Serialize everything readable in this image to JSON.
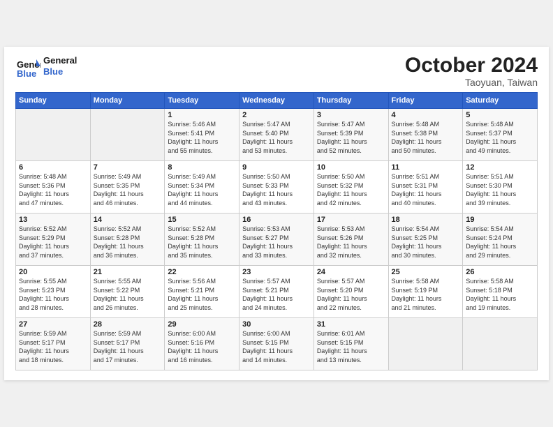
{
  "header": {
    "logo_line1": "General",
    "logo_line2": "Blue",
    "month": "October 2024",
    "location": "Taoyuan, Taiwan"
  },
  "days_of_week": [
    "Sunday",
    "Monday",
    "Tuesday",
    "Wednesday",
    "Thursday",
    "Friday",
    "Saturday"
  ],
  "weeks": [
    [
      {
        "day": "",
        "info": ""
      },
      {
        "day": "",
        "info": ""
      },
      {
        "day": "1",
        "info": "Sunrise: 5:46 AM\nSunset: 5:41 PM\nDaylight: 11 hours\nand 55 minutes."
      },
      {
        "day": "2",
        "info": "Sunrise: 5:47 AM\nSunset: 5:40 PM\nDaylight: 11 hours\nand 53 minutes."
      },
      {
        "day": "3",
        "info": "Sunrise: 5:47 AM\nSunset: 5:39 PM\nDaylight: 11 hours\nand 52 minutes."
      },
      {
        "day": "4",
        "info": "Sunrise: 5:48 AM\nSunset: 5:38 PM\nDaylight: 11 hours\nand 50 minutes."
      },
      {
        "day": "5",
        "info": "Sunrise: 5:48 AM\nSunset: 5:37 PM\nDaylight: 11 hours\nand 49 minutes."
      }
    ],
    [
      {
        "day": "6",
        "info": "Sunrise: 5:48 AM\nSunset: 5:36 PM\nDaylight: 11 hours\nand 47 minutes."
      },
      {
        "day": "7",
        "info": "Sunrise: 5:49 AM\nSunset: 5:35 PM\nDaylight: 11 hours\nand 46 minutes."
      },
      {
        "day": "8",
        "info": "Sunrise: 5:49 AM\nSunset: 5:34 PM\nDaylight: 11 hours\nand 44 minutes."
      },
      {
        "day": "9",
        "info": "Sunrise: 5:50 AM\nSunset: 5:33 PM\nDaylight: 11 hours\nand 43 minutes."
      },
      {
        "day": "10",
        "info": "Sunrise: 5:50 AM\nSunset: 5:32 PM\nDaylight: 11 hours\nand 42 minutes."
      },
      {
        "day": "11",
        "info": "Sunrise: 5:51 AM\nSunset: 5:31 PM\nDaylight: 11 hours\nand 40 minutes."
      },
      {
        "day": "12",
        "info": "Sunrise: 5:51 AM\nSunset: 5:30 PM\nDaylight: 11 hours\nand 39 minutes."
      }
    ],
    [
      {
        "day": "13",
        "info": "Sunrise: 5:52 AM\nSunset: 5:29 PM\nDaylight: 11 hours\nand 37 minutes."
      },
      {
        "day": "14",
        "info": "Sunrise: 5:52 AM\nSunset: 5:28 PM\nDaylight: 11 hours\nand 36 minutes."
      },
      {
        "day": "15",
        "info": "Sunrise: 5:52 AM\nSunset: 5:28 PM\nDaylight: 11 hours\nand 35 minutes."
      },
      {
        "day": "16",
        "info": "Sunrise: 5:53 AM\nSunset: 5:27 PM\nDaylight: 11 hours\nand 33 minutes."
      },
      {
        "day": "17",
        "info": "Sunrise: 5:53 AM\nSunset: 5:26 PM\nDaylight: 11 hours\nand 32 minutes."
      },
      {
        "day": "18",
        "info": "Sunrise: 5:54 AM\nSunset: 5:25 PM\nDaylight: 11 hours\nand 30 minutes."
      },
      {
        "day": "19",
        "info": "Sunrise: 5:54 AM\nSunset: 5:24 PM\nDaylight: 11 hours\nand 29 minutes."
      }
    ],
    [
      {
        "day": "20",
        "info": "Sunrise: 5:55 AM\nSunset: 5:23 PM\nDaylight: 11 hours\nand 28 minutes."
      },
      {
        "day": "21",
        "info": "Sunrise: 5:55 AM\nSunset: 5:22 PM\nDaylight: 11 hours\nand 26 minutes."
      },
      {
        "day": "22",
        "info": "Sunrise: 5:56 AM\nSunset: 5:21 PM\nDaylight: 11 hours\nand 25 minutes."
      },
      {
        "day": "23",
        "info": "Sunrise: 5:57 AM\nSunset: 5:21 PM\nDaylight: 11 hours\nand 24 minutes."
      },
      {
        "day": "24",
        "info": "Sunrise: 5:57 AM\nSunset: 5:20 PM\nDaylight: 11 hours\nand 22 minutes."
      },
      {
        "day": "25",
        "info": "Sunrise: 5:58 AM\nSunset: 5:19 PM\nDaylight: 11 hours\nand 21 minutes."
      },
      {
        "day": "26",
        "info": "Sunrise: 5:58 AM\nSunset: 5:18 PM\nDaylight: 11 hours\nand 19 minutes."
      }
    ],
    [
      {
        "day": "27",
        "info": "Sunrise: 5:59 AM\nSunset: 5:17 PM\nDaylight: 11 hours\nand 18 minutes."
      },
      {
        "day": "28",
        "info": "Sunrise: 5:59 AM\nSunset: 5:17 PM\nDaylight: 11 hours\nand 17 minutes."
      },
      {
        "day": "29",
        "info": "Sunrise: 6:00 AM\nSunset: 5:16 PM\nDaylight: 11 hours\nand 16 minutes."
      },
      {
        "day": "30",
        "info": "Sunrise: 6:00 AM\nSunset: 5:15 PM\nDaylight: 11 hours\nand 14 minutes."
      },
      {
        "day": "31",
        "info": "Sunrise: 6:01 AM\nSunset: 5:15 PM\nDaylight: 11 hours\nand 13 minutes."
      },
      {
        "day": "",
        "info": ""
      },
      {
        "day": "",
        "info": ""
      }
    ]
  ]
}
